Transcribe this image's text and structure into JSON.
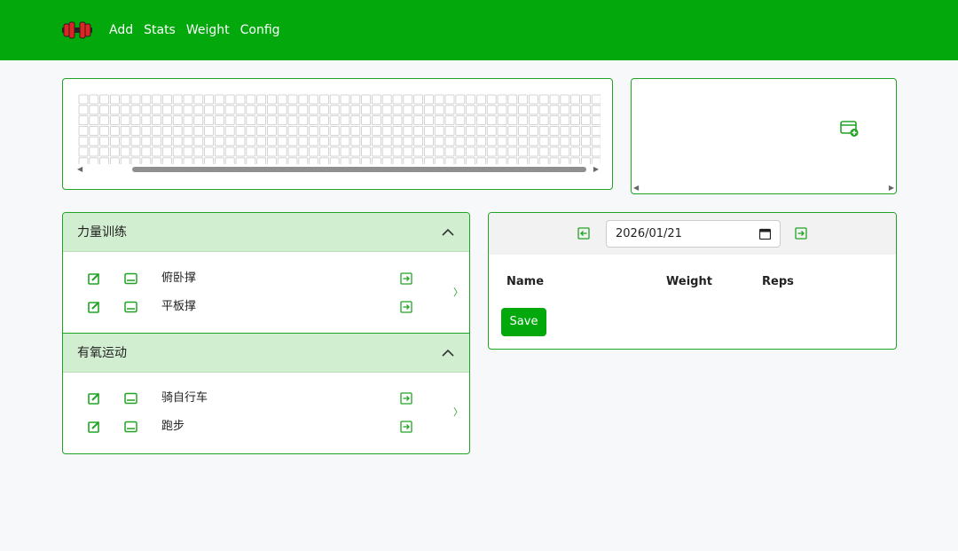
{
  "nav": {
    "items": [
      {
        "label": "Add"
      },
      {
        "label": "Stats"
      },
      {
        "label": "Weight"
      },
      {
        "label": "Config"
      }
    ]
  },
  "colors": {
    "brand": "#02a80c",
    "border": "#21a324",
    "group_header": "#d2eed1"
  },
  "heatmap": {
    "rows": 7,
    "weeks": 50
  },
  "groups": [
    {
      "title": "力量训练",
      "exercises": [
        {
          "name": "俯卧撑"
        },
        {
          "name": "平板撑"
        }
      ]
    },
    {
      "title": "有氧运动",
      "exercises": [
        {
          "name": "骑自行车"
        },
        {
          "name": "跑步"
        }
      ]
    }
  ],
  "log": {
    "date": "2026/01/21",
    "columns": [
      "Name",
      "Weight",
      "Reps"
    ],
    "save_label": "Save"
  },
  "icons": {
    "logo": "dumbbell-icon",
    "add": "add-card-icon",
    "edit": "edit-icon",
    "card": "card-icon",
    "go": "go-icon",
    "collapse": "chevron-up-icon",
    "prev": "arrow-left-icon",
    "next": "arrow-right-icon"
  }
}
